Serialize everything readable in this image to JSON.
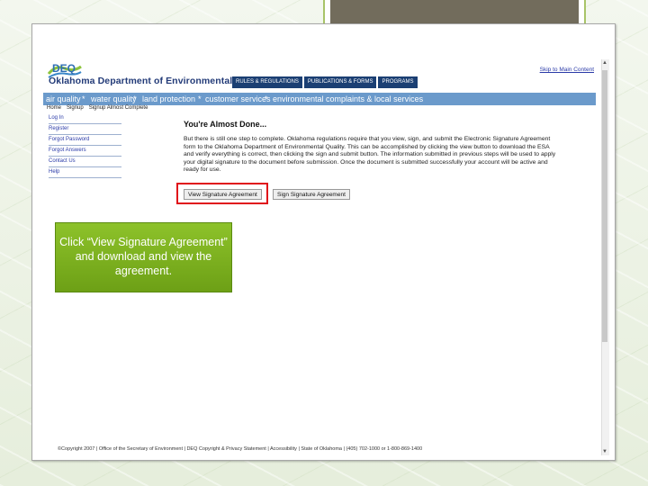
{
  "site": {
    "logo_text": "DEQ",
    "agency_name": "Oklahoma Department of Environmental Quality",
    "skip_link": "Skip to Main Content"
  },
  "top_nav": [
    "RULES & REGULATIONS",
    "PUBLICATIONS & FORMS",
    "PROGRAMS"
  ],
  "blue_bar": [
    "air quality",
    "water quality",
    "land protection",
    "customer services",
    "environmental complaints & local services"
  ],
  "breadcrumb": [
    "Home",
    "Signup",
    "Signup Almost Complete"
  ],
  "side_nav": [
    "Log In",
    "Register",
    "Forgot Password",
    "Forgot Answers",
    "Contact Us",
    "Help"
  ],
  "main": {
    "title": "You're Almost Done...",
    "body": "But there is still one step to complete. Oklahoma regulations require that you view, sign, and submit the Electronic Signature Agreement form to the Oklahoma Department of Environmental Quality. This can be accomplished by clicking the view button to download the ESA and verify everything is correct, then clicking the sign and submit button. The information submitted in previous steps will be used to apply your digital signature to the document before submission. Once the document is submitted successfully your account will be active and ready for use.",
    "view_button": "View Signature Agreement",
    "sign_button": "Sign Signature Agreement"
  },
  "footer": "©Copyright 2007 | Office of the Secretary of Environment | DEQ Copyright & Privacy Statement | Accessibility | State of Oklahoma | (405) 702-1000 or 1-800-869-1400",
  "callout": "Click “View Signature Agreement” and download and view the agreement."
}
